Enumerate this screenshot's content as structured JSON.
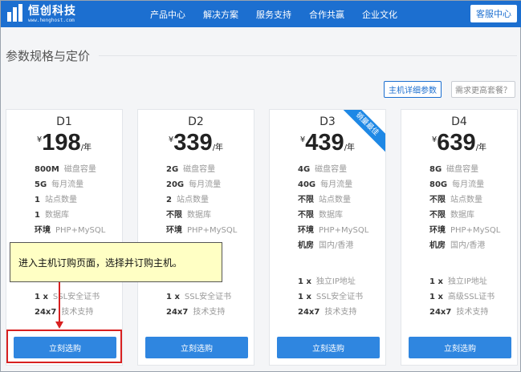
{
  "header": {
    "logo_name": "恒创科技",
    "logo_domain": "www.henghost.com",
    "nav": [
      "产品中心",
      "解决方案",
      "服务支持",
      "合作共赢",
      "企业文化"
    ],
    "service_label": "客服中心"
  },
  "main": {
    "title": "参数规格与定价",
    "detail_button": "主机详细参数",
    "more_button": "需求更高套餐？"
  },
  "plans": [
    {
      "name": "D1",
      "currency": "¥",
      "price": "198",
      "unit": "/年",
      "specs": [
        {
          "v": "800M",
          "k": "磁盘容量"
        },
        {
          "v": "5G",
          "k": "每月流量"
        },
        {
          "v": "1",
          "k": "站点数量"
        },
        {
          "v": "1",
          "k": "数据库"
        },
        {
          "v": "环境",
          "k": "PHP+MySQL"
        }
      ],
      "extras": [
        {
          "v": "1 x",
          "k": "SSL安全证书"
        },
        {
          "v": "24x7",
          "k": "技术支持"
        }
      ],
      "buy": "立刻选购"
    },
    {
      "name": "D2",
      "currency": "¥",
      "price": "339",
      "unit": "/年",
      "specs": [
        {
          "v": "2G",
          "k": "磁盘容量"
        },
        {
          "v": "20G",
          "k": "每月流量"
        },
        {
          "v": "2",
          "k": "站点数量"
        },
        {
          "v": "不限",
          "k": "数据库"
        },
        {
          "v": "环境",
          "k": "PHP+MySQL"
        }
      ],
      "extras": [
        {
          "v": "1 x",
          "k": "SSL安全证书"
        },
        {
          "v": "24x7",
          "k": "技术支持"
        }
      ],
      "buy": "立刻选购"
    },
    {
      "name": "D3",
      "currency": "¥",
      "price": "439",
      "unit": "/年",
      "ribbon": "销量最佳",
      "specs": [
        {
          "v": "4G",
          "k": "磁盘容量"
        },
        {
          "v": "40G",
          "k": "每月流量"
        },
        {
          "v": "不限",
          "k": "站点数量"
        },
        {
          "v": "不限",
          "k": "数据库"
        },
        {
          "v": "环境",
          "k": "PHP+MySQL"
        },
        {
          "v": "机房",
          "k": "国内/香港"
        }
      ],
      "extras": [
        {
          "v": "1 x",
          "k": "独立IP地址"
        },
        {
          "v": "1 x",
          "k": "SSL安全证书"
        },
        {
          "v": "24x7",
          "k": "技术支持"
        }
      ],
      "buy": "立刻选购"
    },
    {
      "name": "D4",
      "currency": "¥",
      "price": "639",
      "unit": "/年",
      "specs": [
        {
          "v": "8G",
          "k": "磁盘容量"
        },
        {
          "v": "80G",
          "k": "每月流量"
        },
        {
          "v": "不限",
          "k": "站点数量"
        },
        {
          "v": "不限",
          "k": "数据库"
        },
        {
          "v": "环境",
          "k": "PHP+MySQL"
        },
        {
          "v": "机房",
          "k": "国内/香港"
        }
      ],
      "extras": [
        {
          "v": "1 x",
          "k": "独立IP地址"
        },
        {
          "v": "1 x",
          "k": "高级SSL证书"
        },
        {
          "v": "24x7",
          "k": "技术支持"
        }
      ],
      "buy": "立刻选购"
    }
  ],
  "annotation": {
    "text": "进入主机订购页面，选择并订购主机。",
    "highlight_color": "#d82020",
    "note_bg": "#ffffc4"
  },
  "colors": {
    "brand": "#1c6fd0",
    "button": "#2f86e0"
  }
}
